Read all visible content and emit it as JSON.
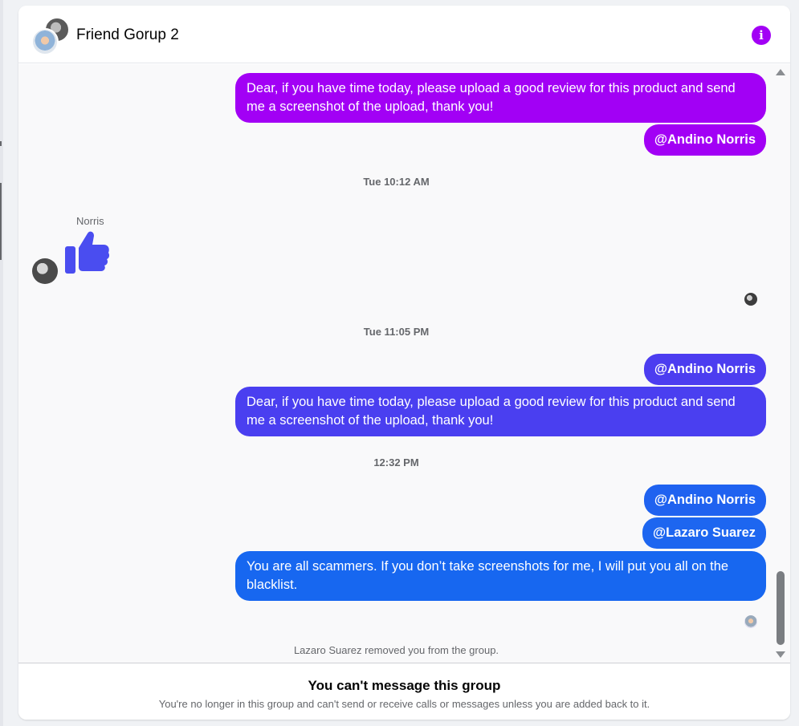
{
  "header": {
    "title": "Friend Gorup 2",
    "info_icon": "info-icon",
    "accent_color": "#a200f5"
  },
  "thread": {
    "messages": [
      {
        "text": "Dear, if you have time today, please upload a good review for this product and send me a screenshot of the upload, thank you!",
        "color": "#a200f5"
      },
      {
        "text": "@Andino Norris",
        "color": "#a200f5"
      }
    ],
    "timestamp_1": "Tue 10:12 AM",
    "norris_name": "Norris",
    "norris_reaction_icon": "thumbs-up-icon",
    "timestamp_2": "Tue 11:05 PM",
    "messages_2": [
      {
        "text": "@Andino Norris",
        "color": "#4c3df0"
      },
      {
        "text": "Dear, if you have time today, please upload a good review for this product and send me a screenshot of the upload, thank you!",
        "color": "#4a3ff0"
      }
    ],
    "timestamp_3": "12:32 PM",
    "messages_3": [
      {
        "text": "@Andino Norris",
        "color": "#1f62f0"
      },
      {
        "text": "@Lazaro Suarez",
        "color": "#1d66f0"
      },
      {
        "text": "You are all scammers. If you don’t take screenshots for me, I will put you all on the blacklist.",
        "color": "#1767f0"
      }
    ],
    "system_note": "Lazaro Suarez removed you from the group."
  },
  "footer": {
    "title": "You can't message this group",
    "subtitle": "You're no longer in this group and can't send or receive calls or messages unless you are added back to it."
  }
}
